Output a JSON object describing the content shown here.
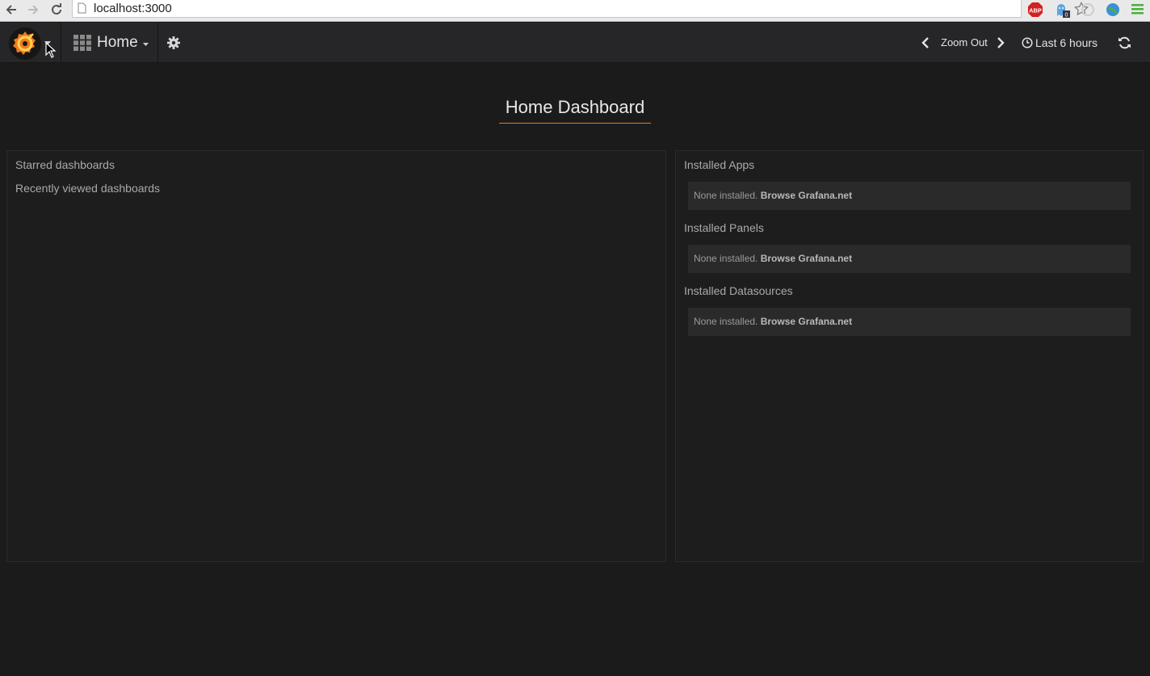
{
  "browser": {
    "url": "localhost:3000",
    "extensions": [
      "ABP",
      "0"
    ]
  },
  "navbar": {
    "dashboard_title": "Home",
    "zoom_out_label": "Zoom Out",
    "time_range_label": "Last 6 hours"
  },
  "page": {
    "title": "Home Dashboard"
  },
  "left_panel": {
    "starred_heading": "Starred dashboards",
    "recent_heading": "Recently viewed dashboards"
  },
  "right_panel": {
    "sections": [
      {
        "heading": "Installed Apps",
        "empty_text": "None installed.",
        "link_text": "Browse Grafana.net"
      },
      {
        "heading": "Installed Panels",
        "empty_text": "None installed.",
        "link_text": "Browse Grafana.net"
      },
      {
        "heading": "Installed Datasources",
        "empty_text": "None installed.",
        "link_text": "Browse Grafana.net"
      }
    ]
  },
  "colors": {
    "background": "#1b1b1c",
    "navbar": "#262628",
    "accent": "#eb7b18"
  }
}
